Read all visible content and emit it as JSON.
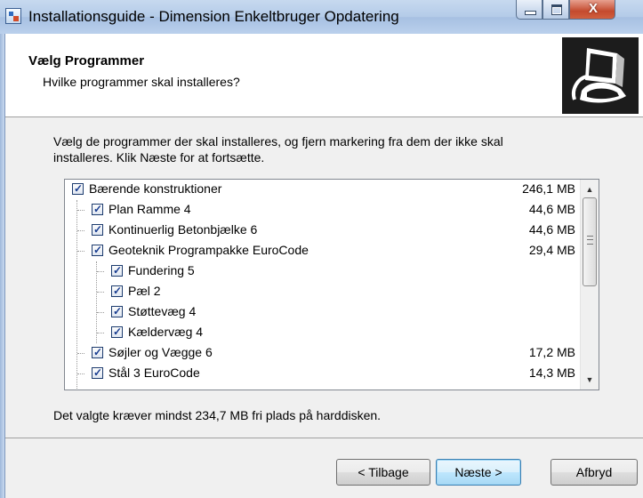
{
  "window": {
    "title": "Installationsguide - Dimension Enkeltbruger Opdatering"
  },
  "header": {
    "title": "Vælg Programmer",
    "subtitle": "Hvilke programmer skal installeres?"
  },
  "main": {
    "description": "Vælg de programmer der skal installeres, og fjern markering fra dem der ikke skal installeres. Klik Næste for at fortsætte.",
    "space_required": "Det valgte kræver mindst 234,7 MB fri plads på harddisken."
  },
  "components": [
    {
      "label": "Bærende konstruktioner",
      "size": "246,1 MB",
      "checked": true
    },
    {
      "label": "Plan Ramme 4",
      "size": "44,6 MB",
      "checked": true
    },
    {
      "label": "Kontinuerlig Betonbjælke 6",
      "size": "44,6 MB",
      "checked": true
    },
    {
      "label": "Geoteknik Programpakke EuroCode",
      "size": "29,4 MB",
      "checked": true
    },
    {
      "label": "Fundering 5",
      "size": "",
      "checked": true
    },
    {
      "label": "Pæl 2",
      "size": "",
      "checked": true
    },
    {
      "label": "Støttevæg 4",
      "size": "",
      "checked": true
    },
    {
      "label": "Kældervæg 4",
      "size": "",
      "checked": true
    },
    {
      "label": "Søjler og Vægge 6",
      "size": "17,2 MB",
      "checked": true
    },
    {
      "label": "Stål 3 EuroCode",
      "size": "14,3 MB",
      "checked": true
    }
  ],
  "buttons": {
    "back": "< Tilbage",
    "next": "Næste >",
    "cancel": "Afbryd"
  },
  "icons": {
    "app": "installer-icon",
    "logo": "computer-install-icon",
    "scroll_up": "▲",
    "scroll_down": "▼",
    "check": "✓",
    "close": "X"
  },
  "colors": {
    "titlebar": "#b4cbe8",
    "dialog_bg": "#f0f0f0",
    "check": "#173b8f"
  }
}
